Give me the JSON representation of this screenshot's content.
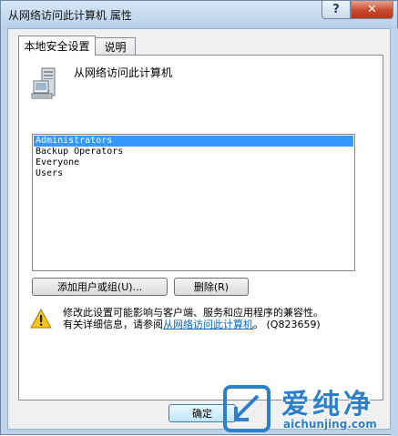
{
  "window": {
    "title": "从网络访问此计算机 属性",
    "help_glyph": "?",
    "close_glyph": "✕"
  },
  "tabs": [
    {
      "label": "本地安全设置",
      "active": true
    },
    {
      "label": "说明",
      "active": false
    }
  ],
  "policy": {
    "name": "从网络访问此计算机",
    "icon": "computer-icon"
  },
  "members": [
    {
      "name": "Administrators",
      "selected": true
    },
    {
      "name": "Backup Operators",
      "selected": false
    },
    {
      "name": "Everyone",
      "selected": false
    },
    {
      "name": "Users",
      "selected": false
    }
  ],
  "buttons": {
    "add": "添加用户或组(U)...",
    "remove": "删除(R)",
    "ok": "确定"
  },
  "warning": {
    "icon": "warning-icon",
    "line1": "修改此设置可能影响与客户端、服务和应用程序的兼容性。",
    "line2_prefix": "有关详细信息，请参阅",
    "line2_link": "从网络访问此计算机",
    "line2_suffix": "。 (Q823659)"
  },
  "watermark": {
    "title": "爱纯净",
    "url": "aichunjing.com"
  },
  "colors": {
    "selection": "#3399ff",
    "link": "#0066cc",
    "close": "#c94a2d",
    "watermark": "#2d7fc9"
  }
}
